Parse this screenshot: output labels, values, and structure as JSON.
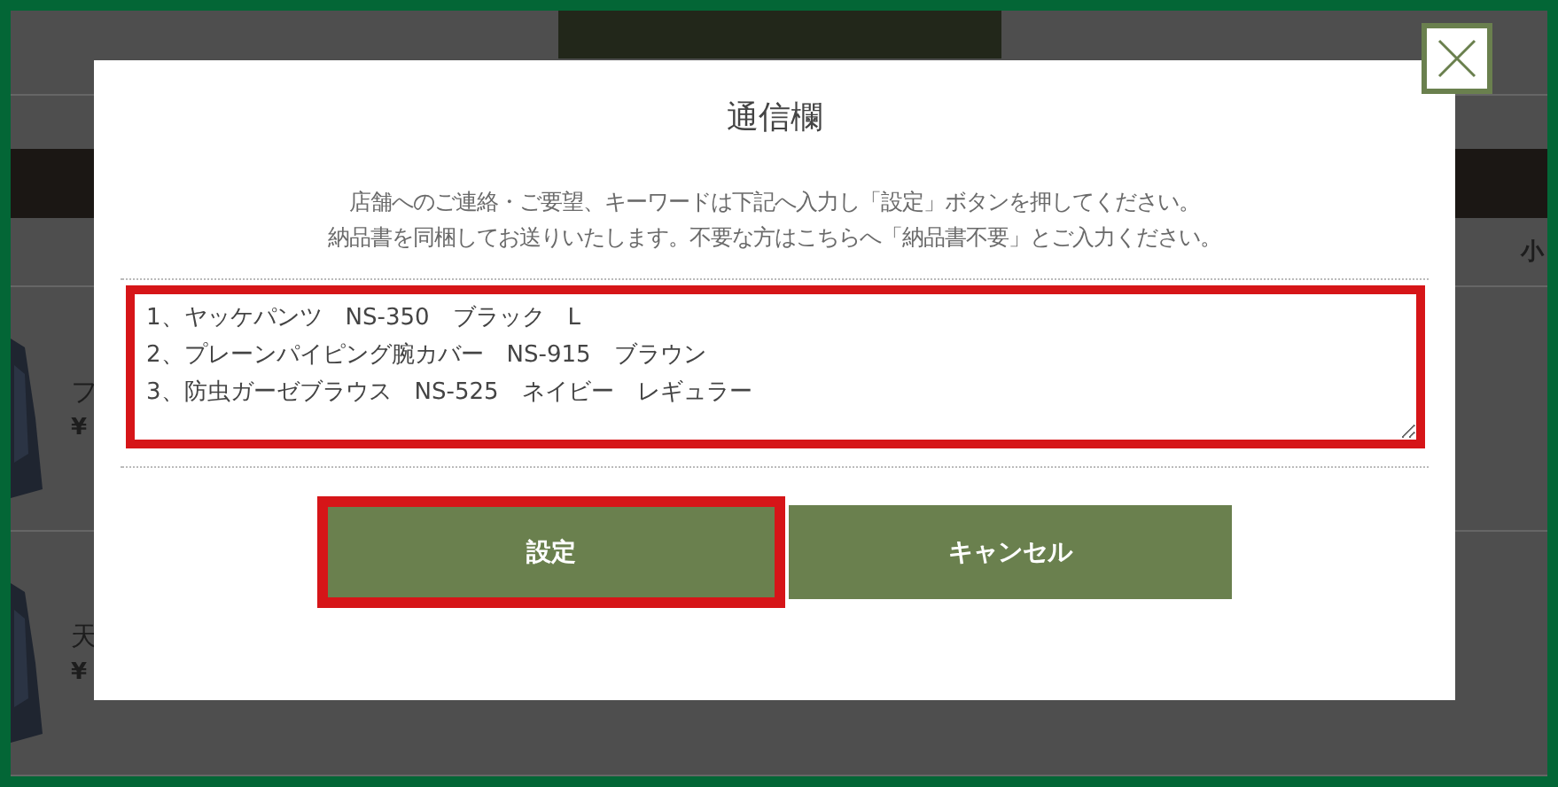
{
  "background": {
    "header_cell": "小",
    "products": [
      {
        "name": "フ",
        "price": "¥"
      },
      {
        "name": "天",
        "price": "¥"
      }
    ]
  },
  "dialog": {
    "title": "通信欄",
    "instructions": [
      "店舗へのご連絡・ご要望、キーワードは下記へ入力し「設定」ボタンを押してください。",
      "納品書を同梱してお送りいたします。不要な方はこちらへ「納品書不要」とご入力ください。"
    ],
    "message": {
      "value": "1、ヤッケパンツ　NS-350　ブラック　L\n2、プレーンパイピング腕カバー　NS-915　ブラウン\n3、防虫ガーゼブラウス　NS-525　ネイビー　レギュラー",
      "highlighted": true
    },
    "buttons": [
      {
        "label": "設定",
        "highlighted": true
      },
      {
        "label": "キャンセル",
        "highlighted": false
      }
    ]
  }
}
